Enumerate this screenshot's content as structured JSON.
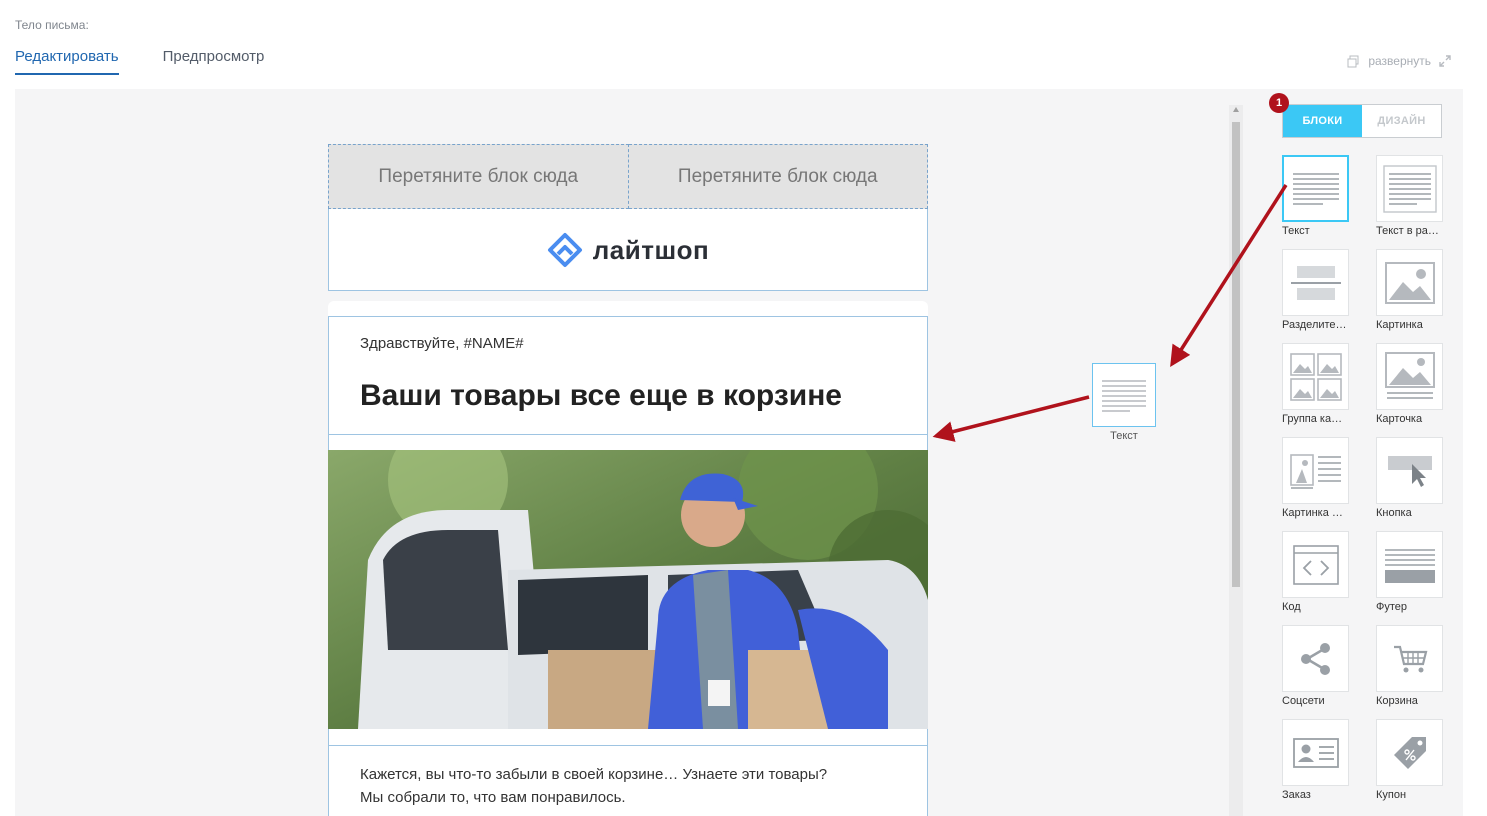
{
  "header": {
    "body_label": "Тело письма:",
    "tabs": [
      {
        "label": "Редактировать",
        "active": true
      },
      {
        "label": "Предпросмотр",
        "active": false
      }
    ],
    "expand_label": "развернуть"
  },
  "email": {
    "drop_zones": [
      "Перетяните блок сюда",
      "Перетяните блок сюда"
    ],
    "logo_text": "лайтшоп",
    "greeting": "Здравствуйте, #NAME#",
    "headline": "Ваши товары все еще в корзине",
    "paragraph_line1": "Кажется, вы что-то забыли в своей корзине… Узнаете эти товары?",
    "paragraph_line2": "Мы собрали то, что вам понравилось."
  },
  "drag_ghost": {
    "label": "Текст"
  },
  "panel": {
    "badge": "1",
    "tabs": [
      {
        "label": "БЛОКИ",
        "active": true
      },
      {
        "label": "ДИЗАЙН",
        "active": false
      }
    ],
    "blocks": [
      {
        "label": "Текст",
        "icon": "text-icon",
        "selected": true
      },
      {
        "label": "Текст в ра…",
        "icon": "text-in-frame-icon",
        "selected": false
      },
      {
        "label": "Разделите…",
        "icon": "divider-icon",
        "selected": false
      },
      {
        "label": "Картинка",
        "icon": "image-icon",
        "selected": false
      },
      {
        "label": "Группа ка…",
        "icon": "image-group-icon",
        "selected": false
      },
      {
        "label": "Карточка",
        "icon": "card-icon",
        "selected": false
      },
      {
        "label": "Картинка …",
        "icon": "image-text-icon",
        "selected": false
      },
      {
        "label": "Кнопка",
        "icon": "button-icon",
        "selected": false
      },
      {
        "label": "Код",
        "icon": "code-icon",
        "selected": false
      },
      {
        "label": "Футер",
        "icon": "footer-icon",
        "selected": false
      },
      {
        "label": "Соцсети",
        "icon": "share-icon",
        "selected": false
      },
      {
        "label": "Корзина",
        "icon": "cart-icon",
        "selected": false
      },
      {
        "label": "Заказ",
        "icon": "order-icon",
        "selected": false
      },
      {
        "label": "Купон",
        "icon": "coupon-icon",
        "selected": false
      }
    ]
  },
  "colors": {
    "accent": "#3bc8f5",
    "tab_active": "#2067b0",
    "block_outline": "#9ec4e2",
    "arrow": "#b0121c",
    "logo_blue": "#4a8df0"
  }
}
